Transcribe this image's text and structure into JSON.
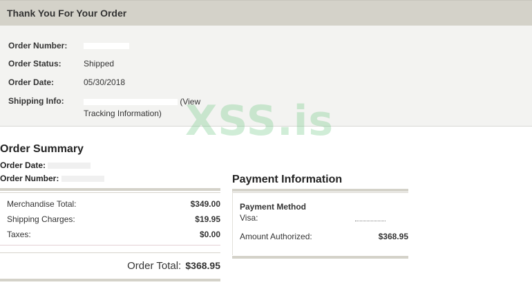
{
  "header": {
    "title": "Thank You For Your Order"
  },
  "order_details": {
    "number_label": "Order Number:",
    "number_value": "",
    "status_label": "Order Status:",
    "status_value": "Shipped",
    "date_label": "Order Date:",
    "date_value": "05/30/2018",
    "shipping_label": "Shipping Info:",
    "shipping_link_text": "(View Tracking Information)"
  },
  "watermark": "XSS.is",
  "summary": {
    "title": "Order Summary",
    "date_label": "Order Date:",
    "number_label": "Order Number:",
    "rows": [
      {
        "label": "Merchandise Total:",
        "value": "$349.00"
      },
      {
        "label": "Shipping Charges:",
        "value": "$19.95"
      },
      {
        "label": "Taxes:",
        "value": "$0.00"
      }
    ],
    "total_label": "Order Total:",
    "total_value": "$368.95"
  },
  "payment": {
    "title": "Payment Information",
    "method_heading": "Payment Method",
    "method_value": "Visa:",
    "amount_label": "Amount Authorized:",
    "amount_value": "$368.95"
  }
}
